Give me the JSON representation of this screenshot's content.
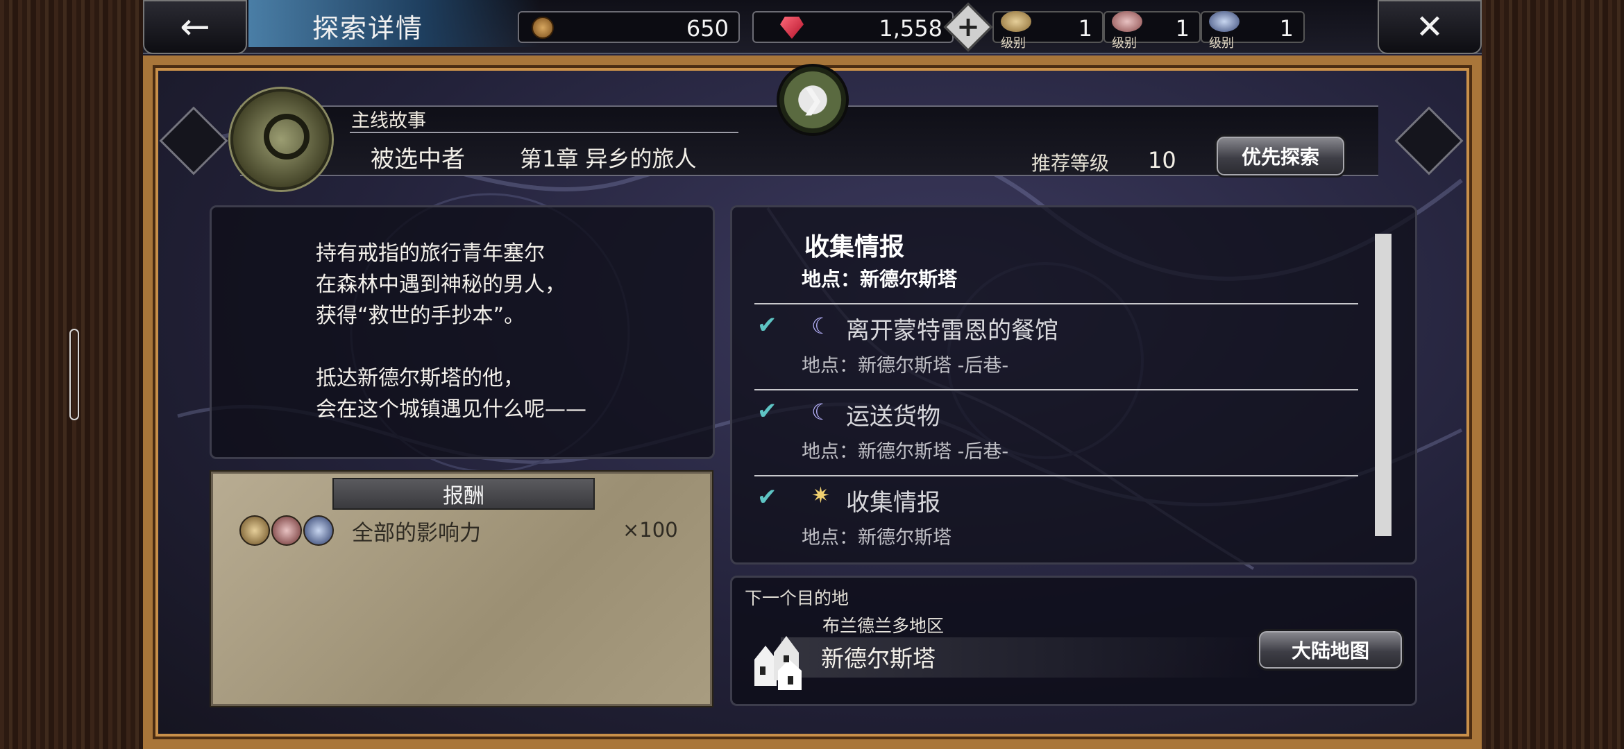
{
  "header": {
    "title": "探索详情",
    "back_label": "←",
    "close_label": "✕",
    "coins": "650",
    "gems": "1,558",
    "add_label": "+",
    "ranks": [
      {
        "label": "级别",
        "value": "1",
        "icon": "wealth-influence-icon",
        "color": "#c9a468"
      },
      {
        "label": "级别",
        "value": "1",
        "icon": "power-influence-icon",
        "color": "#c98a8a"
      },
      {
        "label": "级别",
        "value": "1",
        "icon": "fame-influence-icon",
        "color": "#8a9ec9"
      }
    ]
  },
  "story": {
    "category": "主线故事",
    "name": "被选中者",
    "chapter": "第1章  异乡的旅人",
    "recommend_label": "推荐等级",
    "recommend_value": "10",
    "priority_button": "优先探索"
  },
  "description": "持有戒指的旅行青年塞尔\n在森林中遇到神秘的男人，\n获得“救世的手抄本”。\n\n抵达新德尔斯塔的他，\n会在这个城镇遇见什么呢——",
  "reward": {
    "heading": "报酬",
    "name": "全部的影响力",
    "amount": "×100"
  },
  "info": {
    "title": "收集情报",
    "location": "地点：新德尔斯塔",
    "quests": [
      {
        "title": "离开蒙特雷恩的餐馆",
        "location": "地点：新德尔斯塔 -后巷-",
        "icon": "moon-icon",
        "completed": true
      },
      {
        "title": "运送货物",
        "location": "地点：新德尔斯塔 -后巷-",
        "icon": "moon-icon",
        "completed": true
      },
      {
        "title": "收集情报",
        "location": "地点：新德尔斯塔",
        "icon": "sun-icon",
        "completed": true
      }
    ]
  },
  "next": {
    "heading": "下一个目的地",
    "region": "布兰德兰多地区",
    "city": "新德尔斯塔",
    "map_button": "大陆地图"
  },
  "colors": {
    "accent": "#5ec4c4",
    "frame": "#a9763a",
    "parchment": "#b8ac92"
  }
}
